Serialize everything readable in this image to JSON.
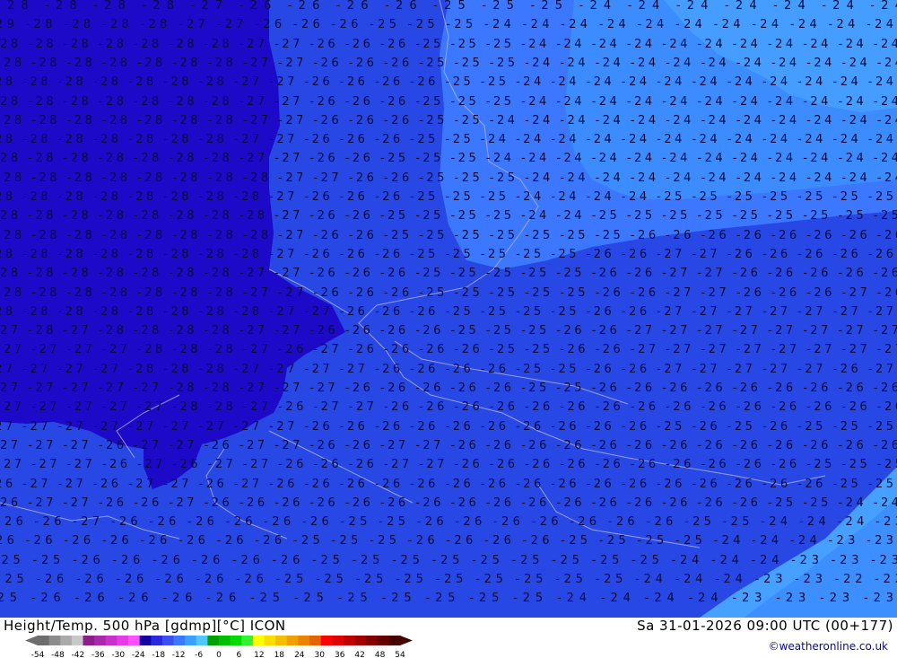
{
  "product": {
    "title": "Height/Temp. 500 hPa [gdmp][°C] ICON",
    "valid_time": "Sa 31-01-2026 09:00 UTC (00+177)",
    "credit": "©weatheronline.co.uk",
    "domain": "Europe"
  },
  "legend": {
    "ticks": [
      "-54",
      "-48",
      "-42",
      "-36",
      "-30",
      "-24",
      "-18",
      "-12",
      "-6",
      "0",
      "6",
      "12",
      "18",
      "24",
      "30",
      "36",
      "42",
      "48",
      "54"
    ],
    "colors": [
      "#6e6e6e",
      "#8c8c8c",
      "#aaaaaa",
      "#c8c8c8",
      "#8c1e8c",
      "#aa28aa",
      "#c832c8",
      "#e63ce6",
      "#ff50ff",
      "#1400a0",
      "#2828dc",
      "#3c50f0",
      "#3c78ff",
      "#3ca0ff",
      "#50c8ff",
      "#00a000",
      "#00be00",
      "#00dc00",
      "#32f032",
      "#ffff00",
      "#fadc00",
      "#f5be00",
      "#f0a000",
      "#eb8200",
      "#e66400",
      "#ff0000",
      "#dc0000",
      "#be0000",
      "#a00000",
      "#820000",
      "#640000",
      "#460000"
    ]
  },
  "map": {
    "colors": {
      "zone_minus28": "#1c0ac8",
      "zone_minus27_26": "#2848e6",
      "zone_minus25": "#3c78ff",
      "zone_minus24": "#3c8cff",
      "zone_minus23": "#46a0ff",
      "border": "#b4b4dc"
    },
    "rows": [
      "-28 -28 -28 -28 -27 -26 -26 -26 -26 -25 -25 -25 -24 -24 -24 -24 -24 -24 -24",
      "-29 -28 -28 -28 -28 -27 -27 -26 -26 -26 -25 -25 -25 -24 -24 -24 -24 -24 -24 -24 -24 -24 -24 -24",
      "-28 -28 -28 -28 -28 -28 -28 -27 -27 -26 -26 -26 -25 -25 -25 -24 -24 -24 -24 -24 -24 -24 -24 -24 -24 -24",
      "-28 -28 -28 -28 -28 -28 -28 -27 -27 -26 -26 -26 -25 -25 -25 -24 -24 -24 -24 -24 -24 -24 -24 -24 -24 -24",
      "-28 -28 -28 -28 -28 -28 -28 -27 -27 -26 -26 -26 -26 -25 -25 -24 -24 -24 -24 -24 -24 -24 -24 -24 -24 -24",
      "-28 -28 -28 -28 -28 -28 -28 -27 -27 -26 -26 -26 -25 -25 -25 -24 -24 -24 -24 -24 -24 -24 -24 -24 -24 -24",
      "-28 -28 -28 -28 -28 -28 -28 -27 -27 -26 -26 -26 -25 -25 -24 -24 -24 -24 -24 -24 -24 -24 -24 -24 -24 -24",
      "-28 -28 -28 -28 -28 -28 -28 -27 -27 -26 -26 -26 -25 -25 -24 -24 -24 -24 -24 -24 -24 -24 -24 -24 -24 -24",
      "-28 -28 -28 -28 -28 -28 -28 -27 -27 -26 -26 -25 -25 -25 -24 -24 -24 -24 -24 -24 -24 -24 -24 -24 -24 -24",
      "-28 -28 -28 -28 -28 -28 -28 -28 -27 -27 -26 -26 -25 -25 -25 -24 -24 -24 -24 -24 -24 -24 -24 -24 -24 -24",
      "-28 -28 -28 -28 -28 -28 -28 -28 -27 -26 -26 -26 -25 -25 -25 -24 -24 -24 -24 -25 -25 -25 -25 -25 -25 -25",
      "-28 -28 -28 -28 -28 -28 -28 -28 -27 -26 -26 -25 -25 -25 -25 -24 -24 -25 -25 -25 -25 -25 -25 -25 -25 -25",
      "-28 -28 -28 -28 -28 -28 -28 -28 -27 -26 -26 -25 -25 -25 -25 -25 -25 -25 -26 -26 -26 -26 -26 -26 -26 -26",
      "-28 -28 -28 -28 -28 -28 -28 -28 -27 -26 -26 -26 -25 -25 -25 -25 -25 -26 -26 -27 -27 -26 -26 -26 -26 -26",
      "-28 -28 -28 -28 -28 -28 -28 -27 -27 -26 -26 -26 -25 -25 -25 -25 -25 -26 -26 -27 -27 -26 -26 -26 -26 -26",
      "-28 -28 -28 -28 -28 -28 -28 -27 -27 -26 -26 -26 -25 -25 -25 -25 -25 -26 -26 -27 -27 -26 -26 -26 -27 -26",
      "-28 -28 -28 -28 -28 -28 -28 -28 -27 -27 -26 -26 -26 -25 -25 -25 -25 -26 -26 -27 -27 -27 -27 -27 -27 -27",
      "-27 -28 -27 -28 -28 -28 -28 -27 -27 -26 -26 -26 -26 -25 -25 -25 -26 -26 -27 -27 -27 -27 -27 -27 -27 -27",
      "-27 -27 -27 -27 -28 -28 -28 -27 -26 -27 -26 -26 -26 -26 -25 -25 -26 -26 -27 -27 -27 -27 -27 -27 -27 -27",
      "-27 -27 -27 -27 -28 -28 -28 -27 -27 -27 -27 -26 -26 -26 -26 -25 -25 -26 -26 -27 -27 -27 -27 -27 -26 -27",
      "-27 -27 -27 -27 -27 -28 -28 -27 -27 -27 -26 -26 -26 -26 -26 -25 -25 -26 -26 -26 -26 -26 -26 -26 -26 -26",
      "-27 -27 -27 -27 -27 -28 -28 -27 -26 -27 -27 -26 -26 -26 -26 -26 -26 -26 -26 -26 -26 -26 -26 -26 -26 -26",
      "-27 -27 -27 -27 -27 -27 -27 -27 -27 -26 -26 -26 -26 -26 -26 -26 -26 -26 -26 -25 -26 -25 -26 -25 -25 -25",
      "-27 -27 -27 -26 -27 -27 -26 -27 -27 -26 -26 -27 -27 -26 -26 -26 -26 -26 -26 -26 -26 -26 -26 -26 -26 -26",
      "-27 -27 -27 -26 -27 -26 -27 -27 -26 -26 -26 -27 -27 -26 -26 -26 -26 -26 -26 -26 -26 -26 -26 -25 -25 -25",
      "-26 -27 -27 -26 -27 -27 -26 -27 -26 -26 -26 -26 -26 -26 -26 -26 -26 -26 -26 -26 -26 -26 -26 -26 -25 -25",
      "-26 -27 -27 -26 -26 -27 -26 -26 -26 -26 -26 -26 -26 -26 -26 -26 -26 -26 -26 -26 -26 -26 -25 -25 -24 -24",
      "-26 -26 -27 -26 -26 -26 -26 -26 -26 -25 -25 -26 -26 -26 -26 -26 -26 -26 -25 -25 -24 -24 -24 -23",
      "-26 -26 -26 -26 -26 -26 -26 -26 -25 -25 -25 -26 -26 -26 -26 -25 -25 -25 -25 -24 -24 -24 -23 -23",
      "-25 -25 -26 -26 -26 -26 -26 -26 -25 -25 -25 -25 -25 -25 -25 -25 -25 -24 -24 -24 -23 -23 -23",
      "-25 -26 -26 -26 -26 -26 -26 -25 -25 -25 -25 -25 -25 -25 -25 -25 -24 -24 -24 -23 -23 -22 -22",
      "-25 -26 -26 -26 -26 -26 -25 -25 -25 -25 -25 -25 -25 -24 -24 -24 -24 -23 -23 -23 -23"
    ]
  }
}
